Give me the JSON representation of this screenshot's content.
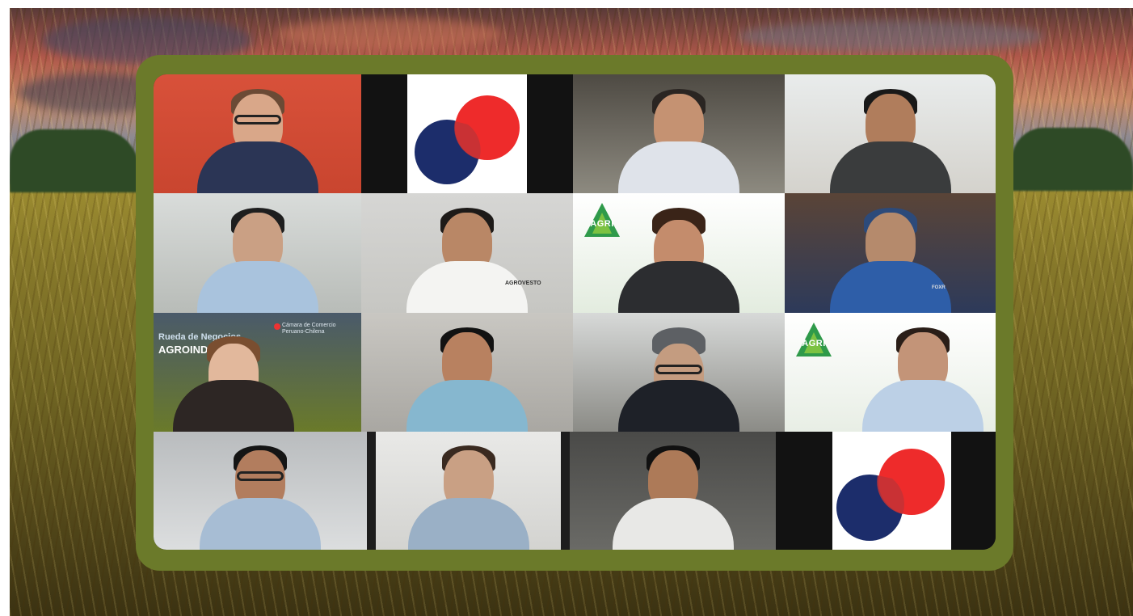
{
  "scene": {
    "description_colors": {
      "frame": "#6b7a2a",
      "sky_top": "#5a3a38",
      "field": "#86782a"
    }
  },
  "meeting": {
    "participant_count": 16,
    "tiles": [
      {
        "kind": "video",
        "icon": "participant-woman-glasses"
      },
      {
        "kind": "logo",
        "icon": "red-blue-circles-logo"
      },
      {
        "kind": "video",
        "icon": "participant-man"
      },
      {
        "kind": "video",
        "icon": "participant-man"
      },
      {
        "kind": "video",
        "icon": "participant-man"
      },
      {
        "kind": "video",
        "icon": "participant-man",
        "shirt_text": "AGROVESTO"
      },
      {
        "kind": "video",
        "icon": "participant-woman",
        "logo_text": "AGRI"
      },
      {
        "kind": "video",
        "icon": "participant-man",
        "background_text": "FOXR"
      },
      {
        "kind": "video",
        "icon": "participant-woman",
        "banner_title": "Rueda de Negocios",
        "banner_subtitle": "AGROINDUSTRIAL",
        "banner_org": "Cámara de Comercio Peruano-Chilena"
      },
      {
        "kind": "video",
        "icon": "participant-man"
      },
      {
        "kind": "video",
        "icon": "participant-man-glasses"
      },
      {
        "kind": "video",
        "icon": "participant-man",
        "logo_text": "AGRI"
      },
      {
        "kind": "video",
        "icon": "participant-man-glasses"
      },
      {
        "kind": "video",
        "icon": "participant-man"
      },
      {
        "kind": "video",
        "icon": "participant-man"
      },
      {
        "kind": "logo",
        "icon": "red-blue-circles-logo"
      }
    ]
  }
}
